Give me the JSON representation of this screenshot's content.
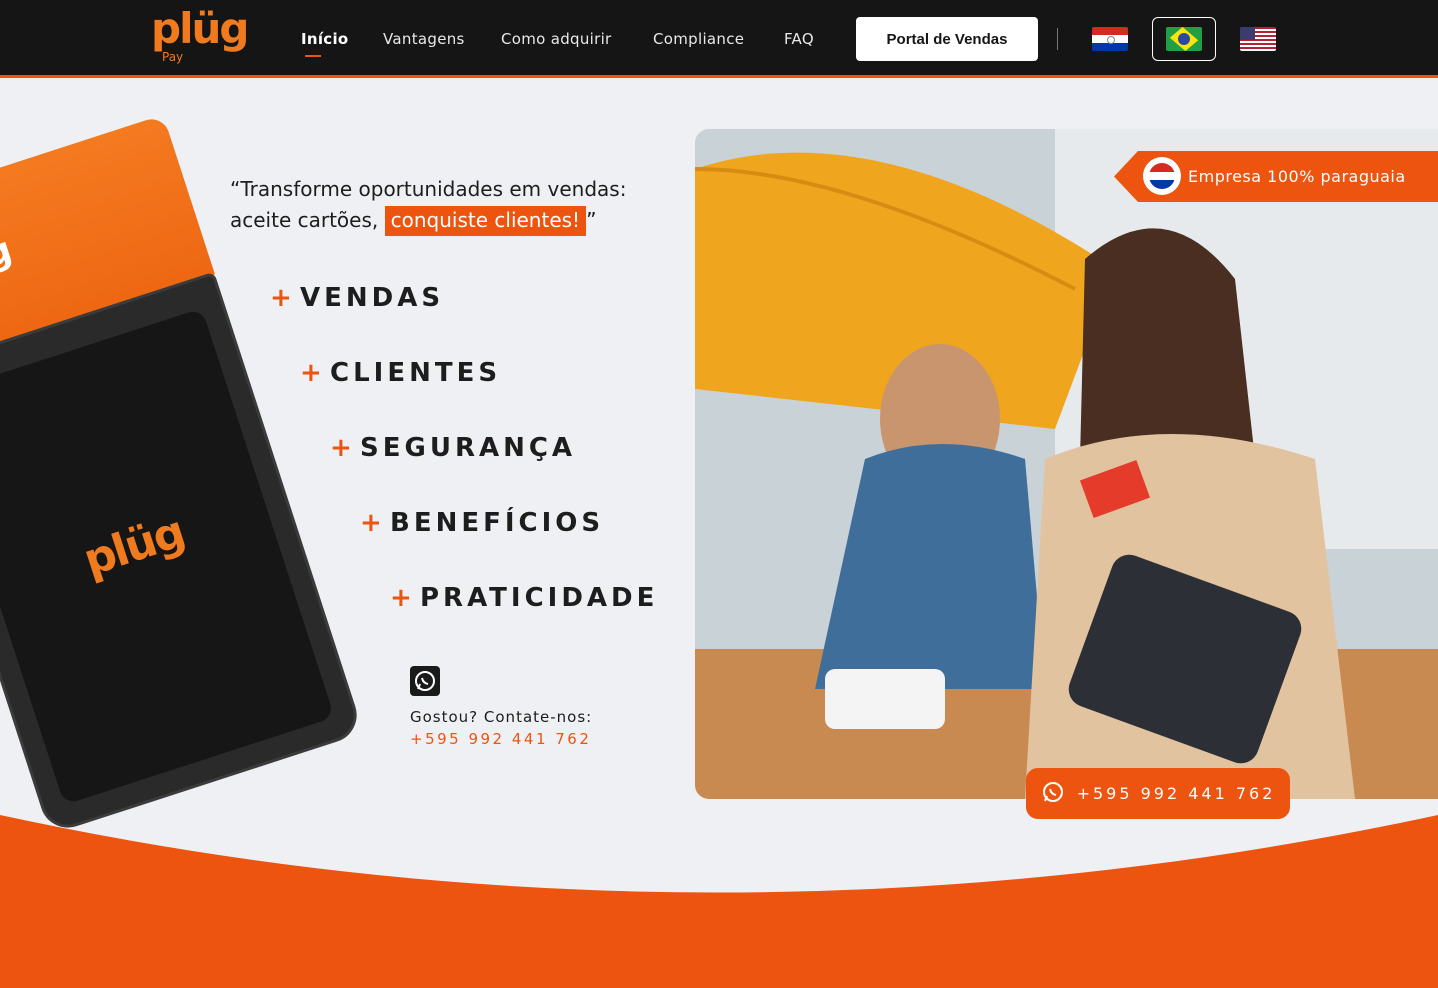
{
  "brand": {
    "logo_text": "plüg",
    "logo_sub": "Pay",
    "accent": "#ec5410"
  },
  "nav": {
    "items": [
      {
        "label": "Início",
        "active": true
      },
      {
        "label": "Vantagens"
      },
      {
        "label": "Como adquirir"
      },
      {
        "label": "Compliance"
      },
      {
        "label": "FAQ"
      }
    ],
    "portal_label": "Portal de Vendas",
    "flags": [
      "paraguay-flag-icon",
      "brazil-flag-icon",
      "usa-flag-icon"
    ]
  },
  "hero": {
    "quote_open": "“Transforme oportunidades em vendas:",
    "quote_line2": "aceite cartões,",
    "quote_highlight": "conquiste clientes!",
    "quote_close": "”",
    "benefits": [
      "VENDAS",
      "CLIENTES",
      "SEGURANÇA",
      "BENEFÍCIOS",
      "PRATICIDADE"
    ],
    "contact_label": "Gostou? Contate-nos:",
    "contact_phone": "+595 992 441 762"
  },
  "photo": {
    "badge_text": "Empresa 100% paraguaia",
    "whatsapp_phone": "+595 992 441 762"
  }
}
